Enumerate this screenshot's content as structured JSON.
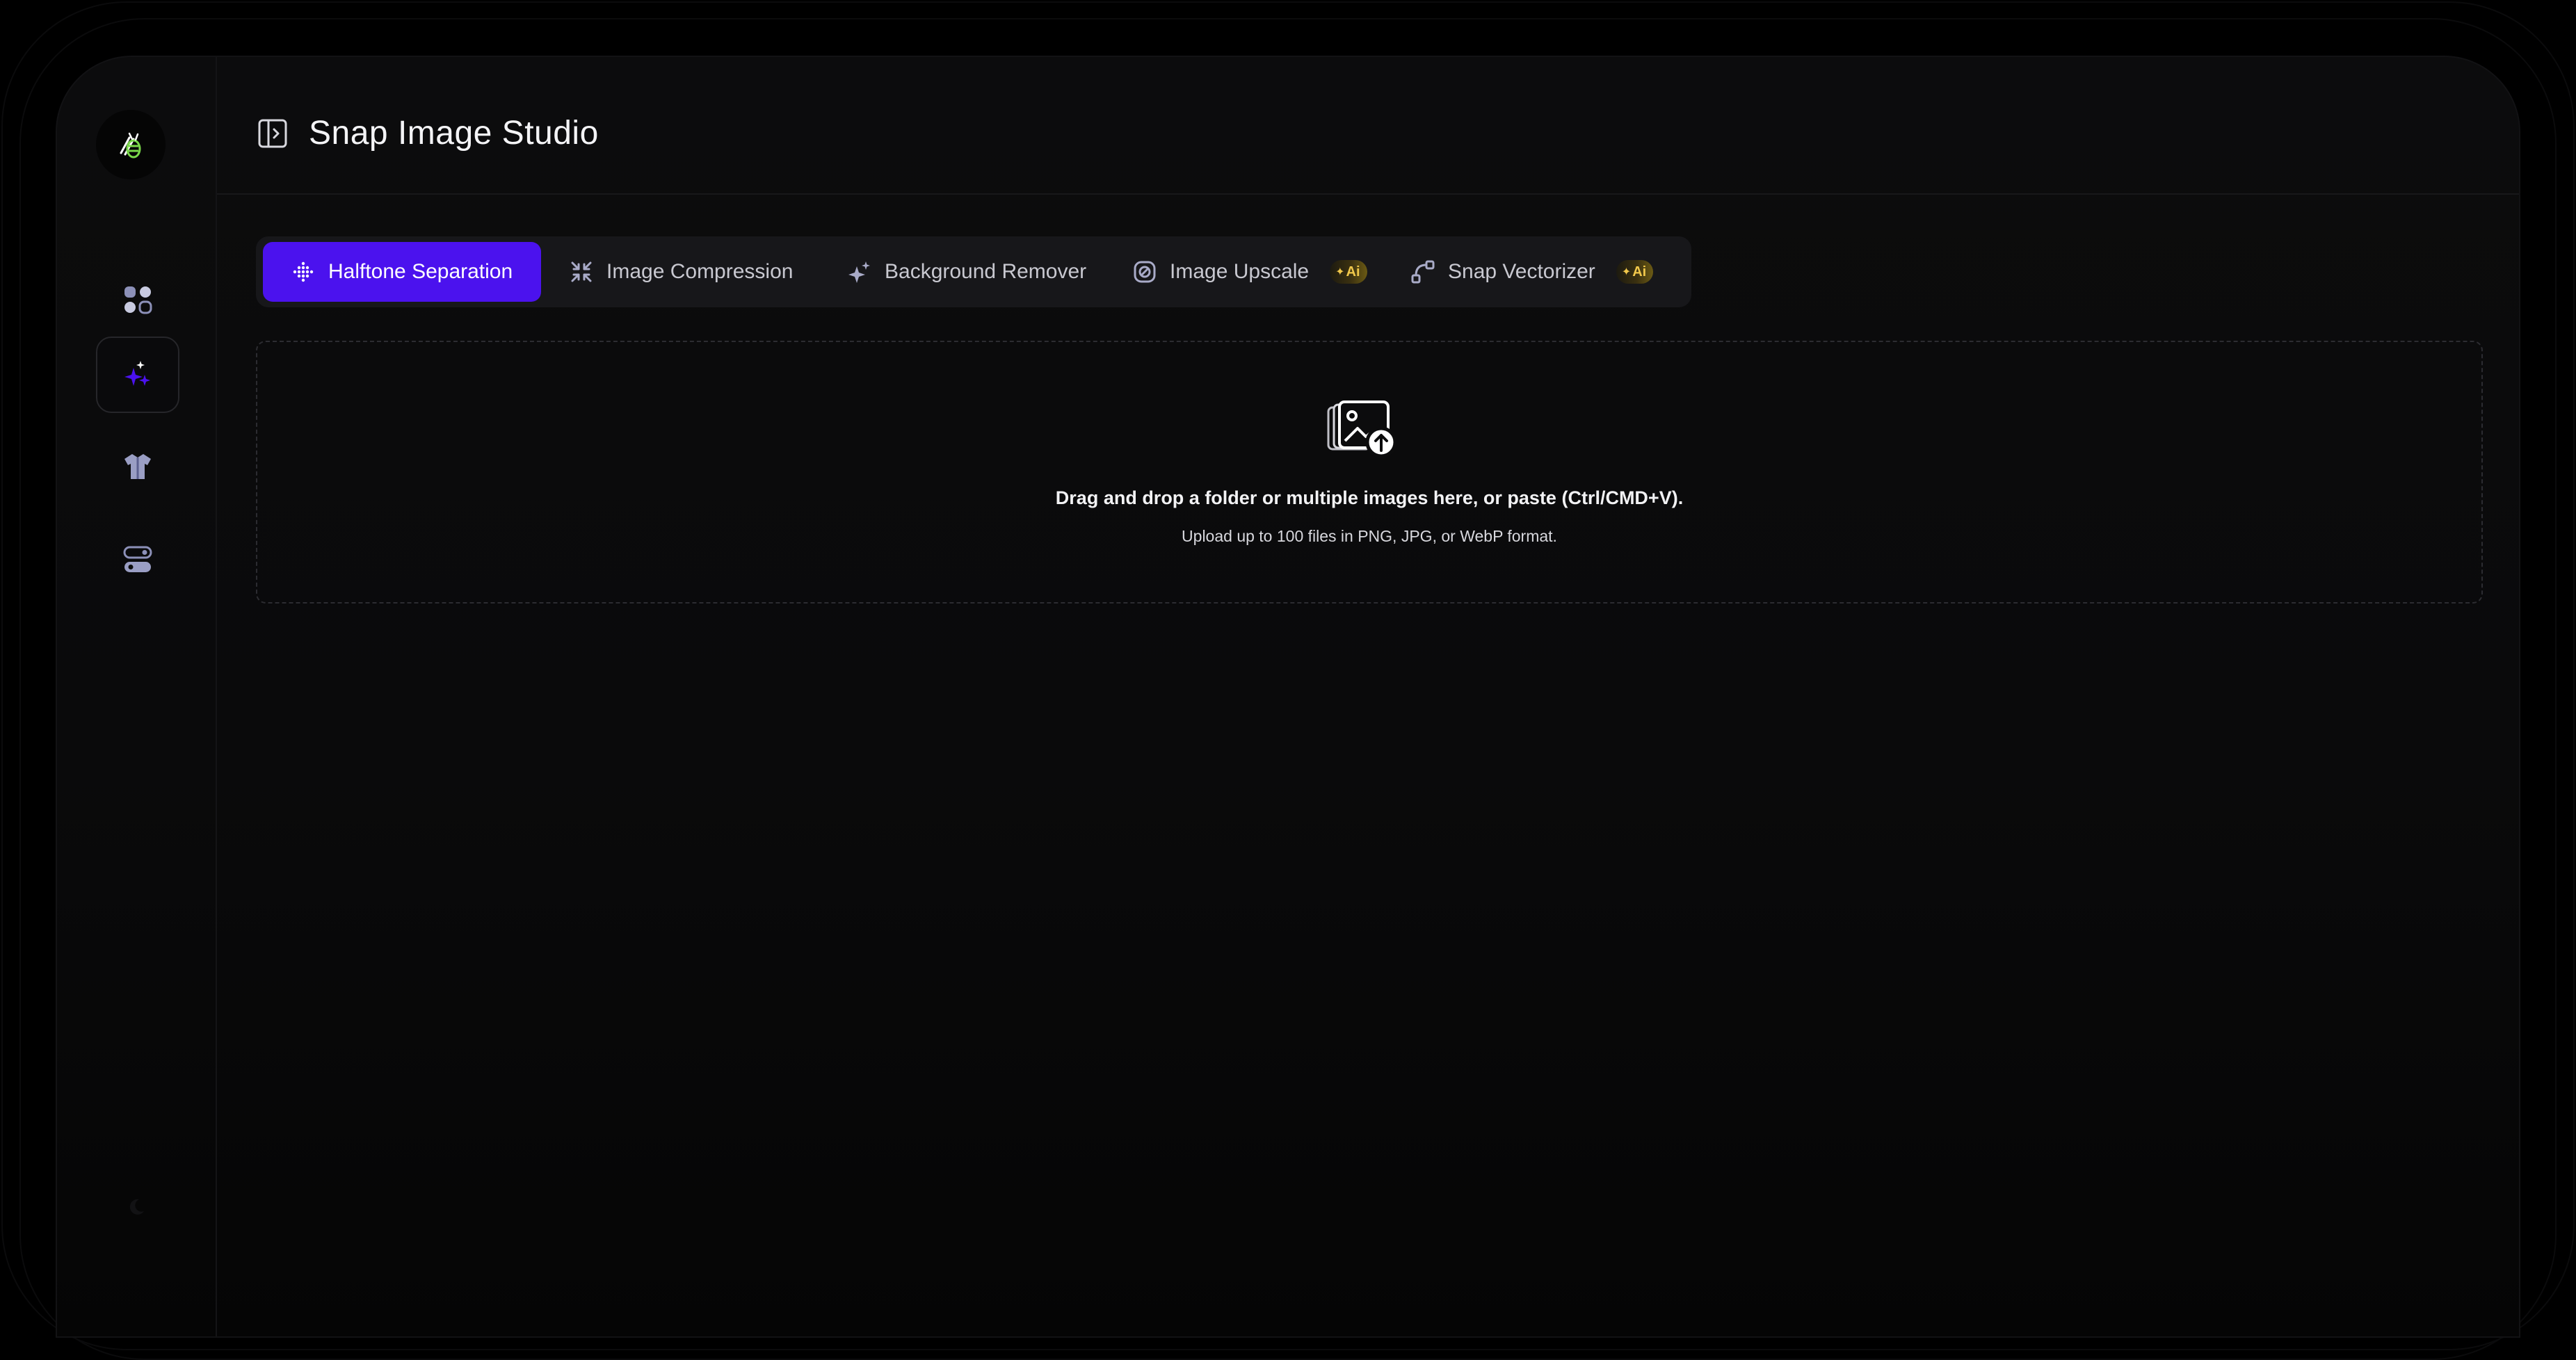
{
  "app": {
    "title": "Snap Image Studio",
    "accent_color": "#4b12ee"
  },
  "sidebar": {
    "logo_icon": "bee-logo-icon",
    "items": [
      {
        "name": "dashboard",
        "icon": "apps-grid-icon",
        "active": false
      },
      {
        "name": "ai-tools",
        "icon": "sparkles-icon",
        "active": true
      },
      {
        "name": "apparel",
        "icon": "tshirt-icon",
        "active": false
      },
      {
        "name": "settings",
        "icon": "toggles-icon",
        "active": false
      }
    ],
    "theme_icon": "moon-icon"
  },
  "header": {
    "panel_toggle_icon": "sidebar-toggle-icon"
  },
  "tabs": [
    {
      "label": "Halftone Separation",
      "icon": "halftone-dots-icon",
      "active": true,
      "badge": ""
    },
    {
      "label": "Image Compression",
      "icon": "compress-arrows-icon",
      "active": false,
      "badge": ""
    },
    {
      "label": "Background Remover",
      "icon": "sparkle-icon",
      "active": false,
      "badge": ""
    },
    {
      "label": "Image Upscale",
      "icon": "upscale-icon",
      "active": false,
      "badge": "Ai"
    },
    {
      "label": "Snap Vectorizer",
      "icon": "vector-path-icon",
      "active": false,
      "badge": "Ai"
    }
  ],
  "dropzone": {
    "icon": "image-upload-icon",
    "primary_text": "Drag and drop a folder or multiple images here, or paste (Ctrl/CMD+V).",
    "secondary_text": "Upload up to 100 files in PNG, JPG, or WebP format."
  }
}
